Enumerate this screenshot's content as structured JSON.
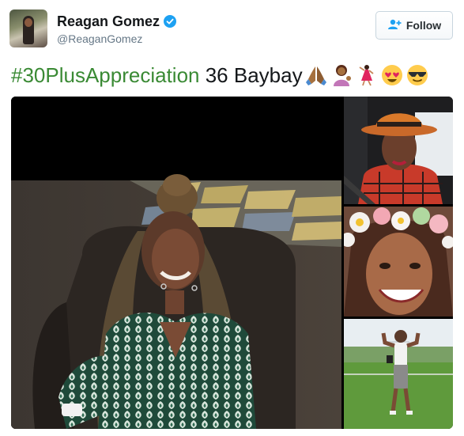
{
  "header": {
    "display_name": "Reagan Gomez",
    "handle": "@ReaganGomez",
    "verified_icon": "verified-badge-icon",
    "avatar_icon": "avatar-photo"
  },
  "follow_button": {
    "label": "Follow",
    "icon": "follow-user-plus-icon"
  },
  "tweet": {
    "hashtag": "#30PlusAppreciation",
    "text": " 36 Baybay",
    "emojis": [
      "folded-hands-icon",
      "woman-tipping-hand-icon",
      "woman-dancing-icon",
      "heart-eyes-face-icon",
      "sunglasses-face-icon"
    ]
  },
  "media": {
    "photos": [
      "main-photo-green-dress",
      "photo-orange-hat",
      "photo-flower-crown",
      "photo-field-flexing"
    ]
  },
  "colors": {
    "hashtag": "#3a8a34",
    "verified": "#1da1f2",
    "handle": "#657786"
  }
}
